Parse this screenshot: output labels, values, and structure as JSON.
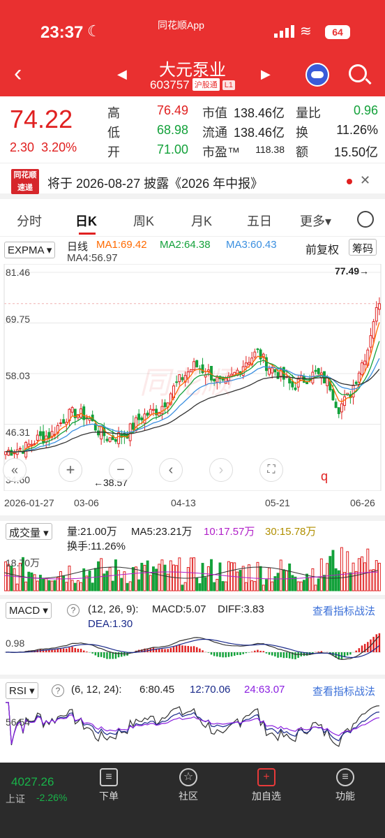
{
  "status": {
    "time": "23:37",
    "app": "同花顺App",
    "battery": "64"
  },
  "header": {
    "name": "大元泵业",
    "code": "603757",
    "badge1": "沪股通",
    "badge2": "L1"
  },
  "quote": {
    "price": "74.22",
    "change": "2.30",
    "change_pct": "3.20%",
    "high_label": "高",
    "high": "76.49",
    "low_label": "低",
    "low": "68.98",
    "open_label": "开",
    "open": "71.00",
    "mcap_label": "市值",
    "mcap": "138.46亿",
    "float_label": "流通",
    "float": "138.46亿",
    "pe_label": "市盈™",
    "pe": "118.38",
    "vr_label": "量比",
    "vr": "0.96",
    "turn_label": "换",
    "turn": "11.26%",
    "amt_label": "额",
    "amt": "15.50亿"
  },
  "notice": {
    "logo1": "同花顺",
    "logo2": "速递",
    "text": "将于 2026-08-27 披露《2026 年中报》",
    "close": "✕"
  },
  "tabs": [
    "分时",
    "日K",
    "周K",
    "月K",
    "五日",
    "更多▾"
  ],
  "kline": {
    "indicator": "EXPMA ▾",
    "period": "日线",
    "ma1": "MA1:69.42",
    "ma2": "MA2:64.38",
    "ma3": "MA3:60.43",
    "ma4": "MA4:56.97",
    "adjust": "前复权",
    "chips": "筹码",
    "y_labels": [
      "81.46",
      "69.75",
      "58.03",
      "46.31",
      "34.60"
    ],
    "max_label": "77.49→",
    "min_label": "←38.57",
    "dates": [
      "2026-01-27",
      "03-06",
      "04-13",
      "05-21",
      "06-26"
    ],
    "watermark": "同花顺"
  },
  "volume": {
    "indicator": "成交量 ▾",
    "vol": "量:21.00万",
    "ma5": "MA5:23.21万",
    "ma10": "10:17.57万",
    "ma30": "30:15.78万",
    "turnover": "换手:11.26%",
    "y_label": "18.70万"
  },
  "macd": {
    "indicator": "MACD ▾",
    "help": "?",
    "params": "(12, 26, 9):",
    "macd": "MACD:5.07",
    "diff": "DIFF:3.83",
    "dea": "DEA:1.30",
    "link": "查看指标战法",
    "y_label": "0.98"
  },
  "rsi": {
    "indicator": "RSI ▾",
    "help": "?",
    "params": "(6, 12, 24):",
    "r6": "6:80.45",
    "r12": "12:70.06",
    "r24": "24:63.07",
    "link": "查看指标战法",
    "y_label": "56.54"
  },
  "bottom": {
    "index_value": "4027.26",
    "index_name": "上证",
    "index_change": "-2.26%",
    "items": [
      "下单",
      "社区",
      "加自选",
      "功能"
    ]
  },
  "chart_data": {
    "type": "candlestick",
    "ylim": [
      34.6,
      81.46
    ],
    "x_ticks": [
      "2026-01-27",
      "03-06",
      "04-13",
      "05-21",
      "06-26"
    ],
    "annotated_high": 77.49,
    "annotated_low": 38.57,
    "last_close": 74.22,
    "ma_values": {
      "MA1": 69.42,
      "MA2": 64.38,
      "MA3": 60.43,
      "MA4": 56.97
    },
    "volume_last": "21.00万",
    "macd_last": {
      "MACD": 5.07,
      "DIFF": 3.83,
      "DEA": 1.3
    },
    "rsi_last": {
      "RSI6": 80.45,
      "RSI12": 70.06,
      "RSI24": 63.07
    },
    "colors": {
      "up": "#e02020",
      "down": "#13a13a",
      "ma1": "#ff6a00",
      "ma2": "#13a13a",
      "ma3": "#3a8fe0",
      "ma4": "#333333"
    }
  }
}
